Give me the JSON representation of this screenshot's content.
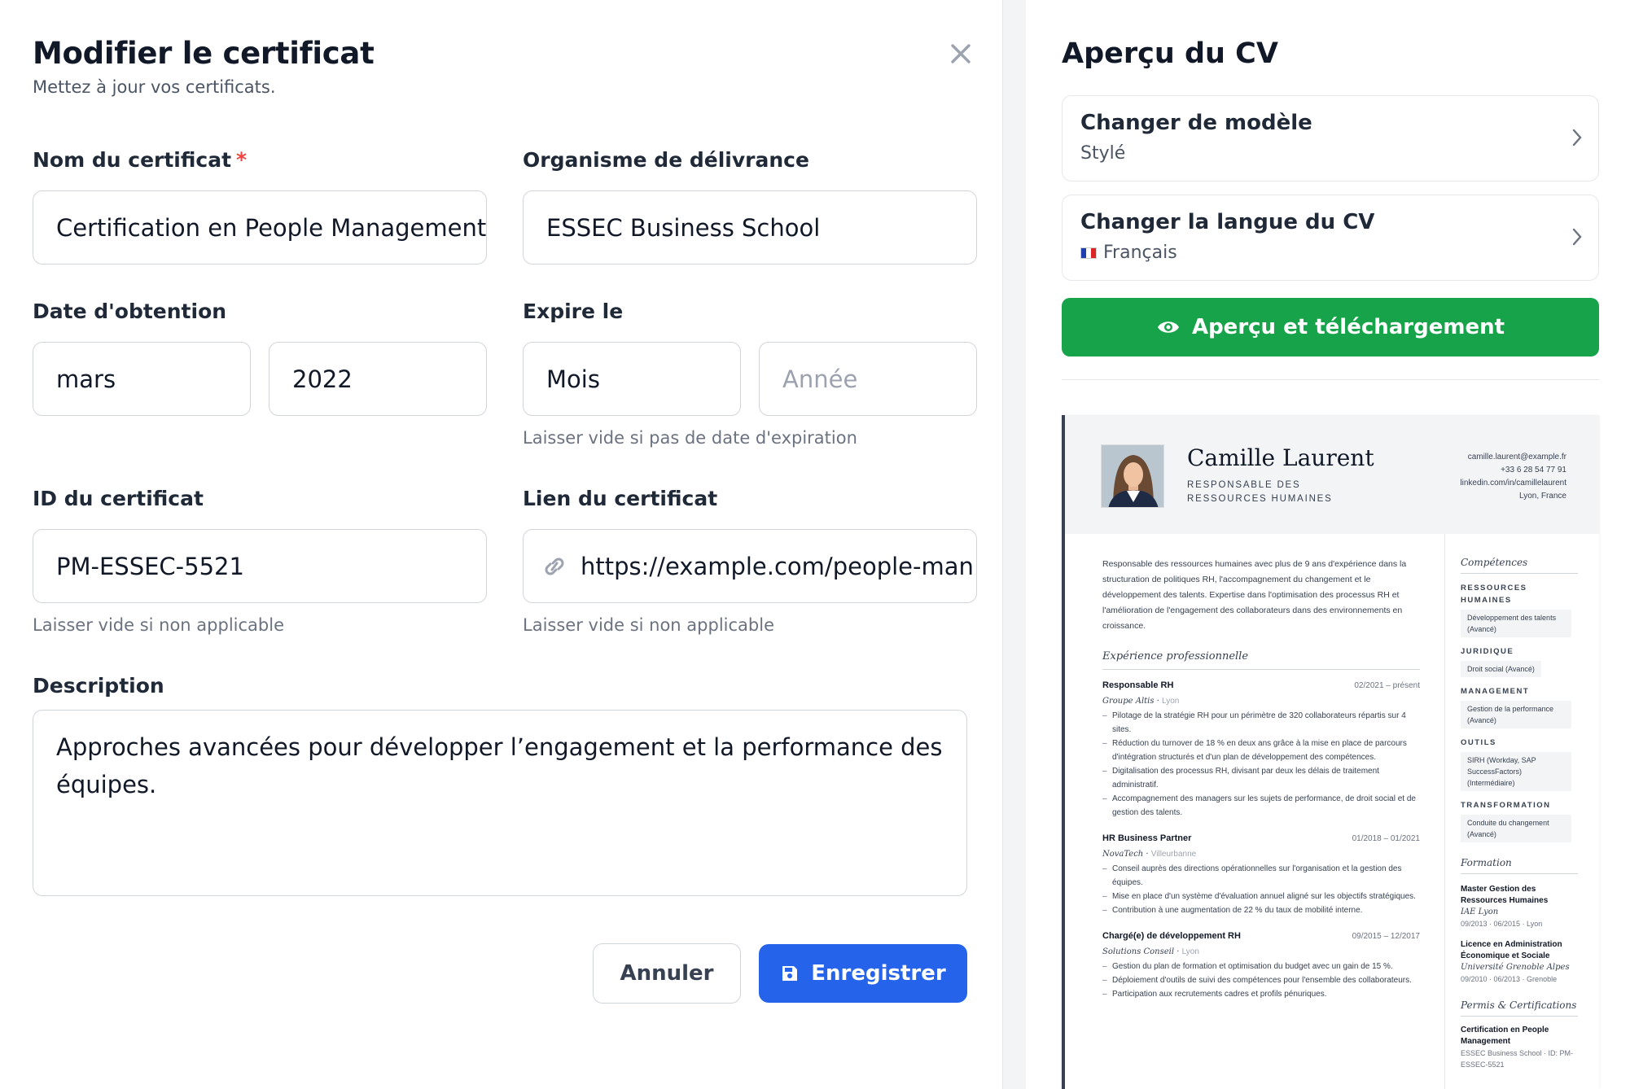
{
  "modal": {
    "title": "Modifier le certificat",
    "subtitle": "Mettez à jour vos certificats."
  },
  "form": {
    "name_label": "Nom du certificat",
    "required_mark": "*",
    "name_value": "Certification en People Management",
    "org_label": "Organisme de délivrance",
    "org_value": "ESSEC Business School",
    "obtained_label": "Date d'obtention",
    "obtained_month": "mars",
    "obtained_year": "2022",
    "expires_label": "Expire le",
    "expires_month": "Mois",
    "expires_year_placeholder": "Année",
    "expires_help": "Laisser vide si pas de date d'expiration",
    "id_label": "ID du certificat",
    "id_value": "PM-ESSEC-5521",
    "id_help": "Laisser vide si non applicable",
    "link_label": "Lien du certificat",
    "link_value": "https://example.com/people-man",
    "link_help": "Laisser vide si non applicable",
    "desc_label": "Description",
    "desc_value": "Approches avancées pour développer l’engagement et la performance des équipes.",
    "cancel": "Annuler",
    "save": "Enregistrer"
  },
  "preview": {
    "title": "Aperçu du CV",
    "template_title": "Changer de modèle",
    "template_value": "Stylé",
    "lang_title": "Changer la langue du CV",
    "lang_value": "Français",
    "download": "Aperçu et téléchargement"
  },
  "cv": {
    "name": "Camille Laurent",
    "role": "RESPONSABLE DES RESSOURCES HUMAINES",
    "email": "camille.laurent@example.fr",
    "phone": "+33 6 28 54 77 91",
    "linkedin": "linkedin.com/in/camillelaurent",
    "location": "Lyon, France",
    "summary": "Responsable des ressources humaines avec plus de 9 ans d'expérience dans la structuration de politiques RH, l'accompagnement du changement et le développement des talents. Expertise dans l'optimisation des processus RH et l'amélioration de l'engagement des collaborateurs dans des environnements en croissance.",
    "exp_title": "Expérience professionnelle",
    "jobs": [
      {
        "title": "Responsable RH",
        "dates": "02/2021 – présent",
        "company": "Groupe Altis",
        "city": "Lyon",
        "bullets": [
          "Pilotage de la stratégie RH pour un périmètre de 320 collaborateurs répartis sur 4 sites.",
          "Réduction du turnover de 18 % en deux ans grâce à la mise en place de parcours d'intégration structurés et d'un plan de développement des compétences.",
          "Digitalisation des processus RH, divisant par deux les délais de traitement administratif.",
          "Accompagnement des managers sur les sujets de performance, de droit social et de gestion des talents."
        ]
      },
      {
        "title": "HR Business Partner",
        "dates": "01/2018 – 01/2021",
        "company": "NovaTech",
        "city": "Villeurbanne",
        "bullets": [
          "Conseil auprès des directions opérationnelles sur l'organisation et la gestion des équipes.",
          "Mise en place d'un système d'évaluation annuel aligné sur les objectifs stratégiques.",
          "Contribution à une augmentation de 22 % du taux de mobilité interne."
        ]
      },
      {
        "title": "Chargé(e) de développement RH",
        "dates": "09/2015 – 12/2017",
        "company": "Solutions Conseil",
        "city": "Lyon",
        "bullets": [
          "Gestion du plan de formation et optimisation du budget avec un gain de 15 %.",
          "Déploiement d'outils de suivi des compétences pour l'ensemble des collaborateurs.",
          "Participation aux recrutements cadres et profils pénuriques."
        ]
      }
    ],
    "skills_title": "Compétences",
    "skills": [
      {
        "cat": "RESSOURCES HUMAINES",
        "item": "Développement des talents (Avancé)"
      },
      {
        "cat": "JURIDIQUE",
        "item": "Droit social (Avancé)"
      },
      {
        "cat": "MANAGEMENT",
        "item": "Gestion de la performance (Avancé)"
      },
      {
        "cat": "OUTILS",
        "item": "SIRH (Workday, SAP SuccessFactors) (Intermédiaire)"
      },
      {
        "cat": "TRANSFORMATION",
        "item": "Conduite du changement (Avancé)"
      }
    ],
    "edu_title": "Formation",
    "education": [
      {
        "degree": "Master Gestion des Ressources Humaines",
        "school": "IAE Lyon",
        "dates": "09/2013 · 06/2015 · Lyon"
      },
      {
        "degree": "Licence en Administration Économique et Sociale",
        "school": "Université Grenoble Alpes",
        "dates": "09/2010 · 06/2013 · Grenoble"
      }
    ],
    "cert_title": "Permis & Certifications",
    "cert_name": "Certification en People Management",
    "cert_detail": "ESSEC Business School · ID: PM-ESSEC-5521"
  },
  "colors": {
    "primary": "#2563eb",
    "success": "#16a34a",
    "required": "#ef4444"
  },
  "icons": [
    "close-icon",
    "chevron-right-icon",
    "link-icon",
    "save-icon",
    "eye-icon",
    "french-flag-icon"
  ]
}
